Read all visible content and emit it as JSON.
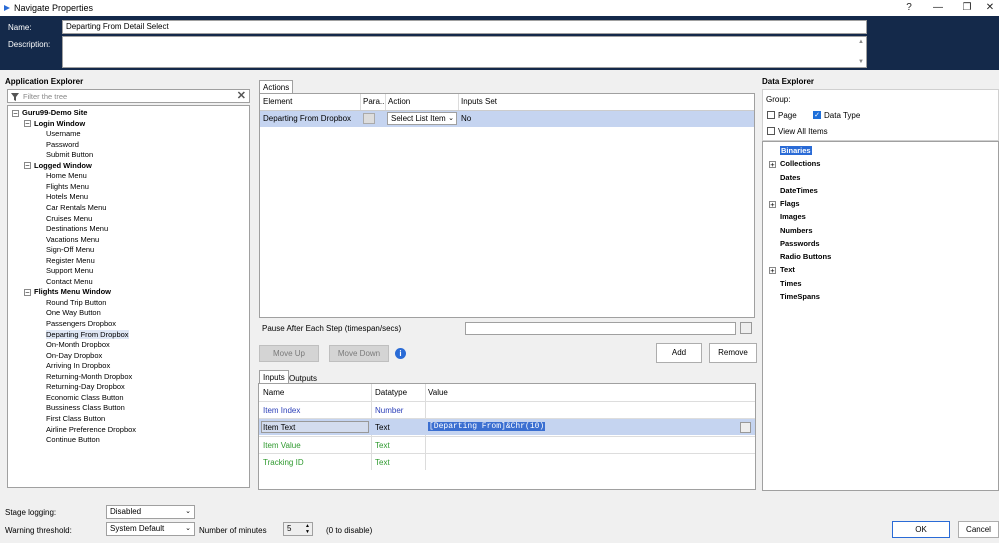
{
  "window": {
    "title": "Navigate Properties",
    "help": "?",
    "min": "—",
    "max": "❐",
    "close": "✕"
  },
  "header": {
    "name_label": "Name:",
    "name_value": "Departing From Detail Select",
    "desc_label": "Description:"
  },
  "app_explorer": {
    "title": "Application Explorer",
    "filter_placeholder": "Filter the tree",
    "tree": [
      {
        "label": "Guru99-Demo Site",
        "level": 0,
        "bold": true,
        "exp": "-"
      },
      {
        "label": "Login Window",
        "level": 1,
        "bold": true,
        "exp": "-"
      },
      {
        "label": "Username",
        "level": 2
      },
      {
        "label": "Password",
        "level": 2
      },
      {
        "label": "Submit Button",
        "level": 2
      },
      {
        "label": "Logged Window",
        "level": 1,
        "bold": true,
        "exp": "-"
      },
      {
        "label": "Home Menu",
        "level": 2
      },
      {
        "label": "Flights Menu",
        "level": 2
      },
      {
        "label": "Hotels Menu",
        "level": 2
      },
      {
        "label": "Car Rentals Menu",
        "level": 2
      },
      {
        "label": "Cruises Menu",
        "level": 2
      },
      {
        "label": "Destinations Menu",
        "level": 2
      },
      {
        "label": "Vacations Menu",
        "level": 2
      },
      {
        "label": "Sign-Off Menu",
        "level": 2
      },
      {
        "label": "Register Menu",
        "level": 2
      },
      {
        "label": "Support Menu",
        "level": 2
      },
      {
        "label": "Contact Menu",
        "level": 2
      },
      {
        "label": "Flights Menu Window",
        "level": 1,
        "bold": true,
        "exp": "-"
      },
      {
        "label": "Round Trip Button",
        "level": 2
      },
      {
        "label": "One Way Button",
        "level": 2
      },
      {
        "label": "Passengers Dropbox",
        "level": 2
      },
      {
        "label": "Departing From Dropbox",
        "level": 2,
        "selected": true
      },
      {
        "label": "On-Month Dropbox",
        "level": 2
      },
      {
        "label": "On-Day Dropbox",
        "level": 2
      },
      {
        "label": "Arriving In Dropbox",
        "level": 2
      },
      {
        "label": "Returning-Month Dropbox",
        "level": 2
      },
      {
        "label": "Returning-Day Dropbox",
        "level": 2
      },
      {
        "label": "Economic Class Button",
        "level": 2
      },
      {
        "label": "Bussiness Class Button",
        "level": 2
      },
      {
        "label": "First Class Button",
        "level": 2
      },
      {
        "label": "Airline Preference Dropbox",
        "level": 2
      },
      {
        "label": "Continue Button",
        "level": 2
      }
    ]
  },
  "actions": {
    "tab": "Actions",
    "columns": [
      "Element",
      "Para...",
      "Action",
      "Inputs Set"
    ],
    "row": {
      "element": "Departing From Dropbox",
      "action": "Select List Item",
      "inputs_set": "No"
    },
    "pause_label": "Pause After Each Step (timespan/secs)",
    "move_up": "Move Up",
    "move_down": "Move Down",
    "add": "Add",
    "remove": "Remove"
  },
  "inputs": {
    "tabs": [
      "Inputs",
      "Outputs"
    ],
    "columns": [
      "Name",
      "Datatype",
      "Value"
    ],
    "rows": [
      {
        "name": "Item Index",
        "datatype": "Number",
        "value": "",
        "color": "#2b3fb8"
      },
      {
        "name": "Item Text",
        "datatype": "Text",
        "value": "[Departing From]&Chr(10)",
        "color": "#000000",
        "selected": true
      },
      {
        "name": "Item Value",
        "datatype": "Text",
        "value": "",
        "color": "#2f9a2f"
      },
      {
        "name": "Tracking ID",
        "datatype": "Text",
        "value": "",
        "color": "#2f9a2f"
      }
    ]
  },
  "data_explorer": {
    "title": "Data Explorer",
    "group_label": "Group:",
    "page": "Page",
    "data_type": "Data Type",
    "view_all": "View All Items",
    "items": [
      {
        "label": "Binaries",
        "exp": "",
        "selected": true
      },
      {
        "label": "Collections",
        "exp": "+"
      },
      {
        "label": "Dates",
        "exp": ""
      },
      {
        "label": "DateTimes",
        "exp": ""
      },
      {
        "label": "Flags",
        "exp": "+"
      },
      {
        "label": "Images",
        "exp": ""
      },
      {
        "label": "Numbers",
        "exp": ""
      },
      {
        "label": "Passwords",
        "exp": ""
      },
      {
        "label": "Radio Buttons",
        "exp": ""
      },
      {
        "label": "Text",
        "exp": "+"
      },
      {
        "label": "Times",
        "exp": ""
      },
      {
        "label": "TimeSpans",
        "exp": ""
      }
    ]
  },
  "footer": {
    "stage_logging_label": "Stage logging:",
    "stage_logging_value": "Disabled",
    "warning_label": "Warning threshold:",
    "warning_value": "System Default",
    "minutes_label": "Number of minutes",
    "minutes_value": "5",
    "disable_hint": "(0 to disable)",
    "ok": "OK",
    "cancel": "Cancel"
  }
}
